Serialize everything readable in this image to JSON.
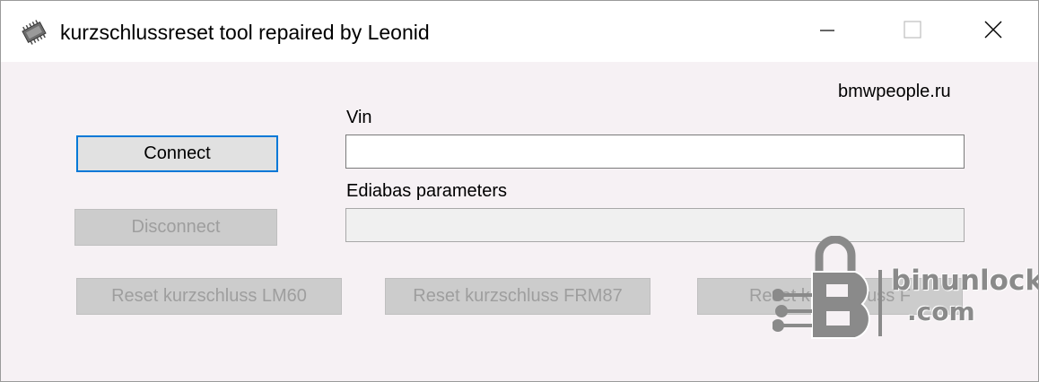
{
  "window": {
    "title": "kurzschlussreset tool repaired by Leonid",
    "icon": "circuit-chip-icon",
    "controls": [
      "minimize-icon",
      "maximize-icon",
      "close-icon"
    ]
  },
  "site_label": "bmwpeople.ru",
  "vin": {
    "label": "Vin",
    "value": ""
  },
  "ediabas": {
    "label": "Ediabas parameters",
    "value": ""
  },
  "buttons": {
    "connect": "Connect",
    "disconnect": "Disconnect",
    "reset_lm60": "Reset kurzschluss LM60",
    "reset_frm87": "Reset kurzschluss FRM87",
    "reset_third": "Reset kurzschluss F"
  },
  "watermark": {
    "name": "binunlock",
    "domain": ".com",
    "color": "#8a8a8a"
  },
  "colors": {
    "focus_border": "#0078d7",
    "window_bg": "#f6f1f4",
    "disabled_text": "#9e9e9e"
  }
}
